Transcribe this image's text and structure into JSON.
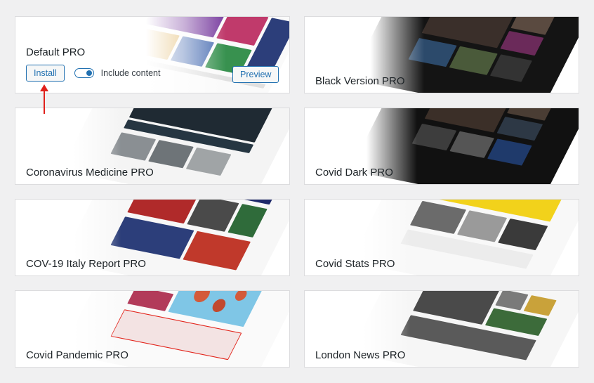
{
  "cards": [
    {
      "title": "Default PRO",
      "theme": "light",
      "accent": "#2f6de1"
    },
    {
      "title": "Black Version PRO",
      "theme": "dark",
      "accent": "#c0392b"
    },
    {
      "title": "Coronavirus Medicine PRO",
      "theme": "dark",
      "accent": "#2c3e50"
    },
    {
      "title": "Covid Dark PRO",
      "theme": "dark",
      "accent": "#1a1a1a"
    },
    {
      "title": "COV-19 Italy Report PRO",
      "theme": "navy",
      "accent": "#1f2a6b"
    },
    {
      "title": "Covid Stats PRO",
      "theme": "yellow",
      "accent": "#f2d21b"
    },
    {
      "title": "Covid Pandemic PRO",
      "theme": "red",
      "accent": "#e2231a"
    },
    {
      "title": "London News PRO",
      "theme": "blue",
      "accent": "#1f6fd0"
    }
  ],
  "default_card": {
    "install_label": "Install",
    "include_content_label": "Include content",
    "include_content_on": true,
    "preview_label": "Preview"
  },
  "colors": {
    "primary": "#2271b1",
    "arrow": "#e0201b"
  }
}
